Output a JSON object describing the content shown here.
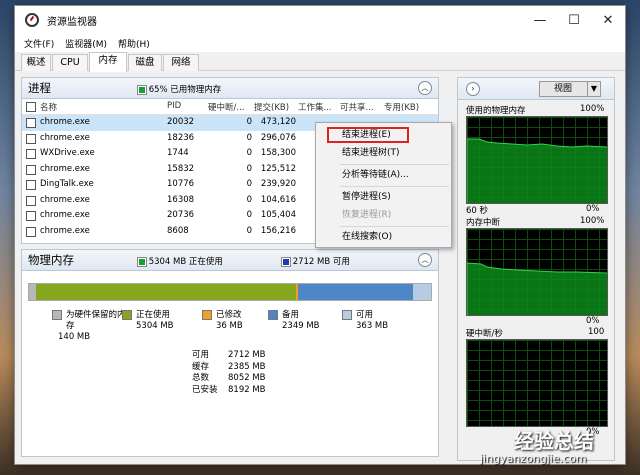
{
  "window": {
    "title": "资源监视器",
    "min": "—",
    "max": "☐",
    "close": "✕"
  },
  "menu": [
    "文件(F)",
    "监视器(M)",
    "帮助(H)"
  ],
  "tabs": [
    "概述",
    "CPU",
    "内存",
    "磁盘",
    "网络"
  ],
  "active_tab": "内存",
  "process": {
    "title": "进程",
    "usage": "65% 已用物理内存",
    "usage_color": "#1e9e2e",
    "columns": [
      "名称",
      "PID",
      "硬中断/...",
      "提交(KB)",
      "工作集...",
      "可共享...",
      "专用(KB)"
    ],
    "rows": [
      {
        "name": "chrome.exe",
        "pid": "20032",
        "hf": "0",
        "commit": "473,120",
        "ws": "",
        "sh": "",
        "pr": "",
        "selected": true
      },
      {
        "name": "chrome.exe",
        "pid": "18236",
        "hf": "0",
        "commit": "296,076",
        "ws": "",
        "sh": "",
        "pr": ""
      },
      {
        "name": "WXDrive.exe",
        "pid": "1744",
        "hf": "0",
        "commit": "158,300",
        "ws": "",
        "sh": "",
        "pr": ""
      },
      {
        "name": "chrome.exe",
        "pid": "15832",
        "hf": "0",
        "commit": "125,512",
        "ws": "",
        "sh": "",
        "pr": ""
      },
      {
        "name": "DingTalk.exe",
        "pid": "10776",
        "hf": "0",
        "commit": "239,920",
        "ws": "",
        "sh": "",
        "pr": ""
      },
      {
        "name": "chrome.exe",
        "pid": "16308",
        "hf": "0",
        "commit": "104,616",
        "ws": "",
        "sh": "",
        "pr": ""
      },
      {
        "name": "chrome.exe",
        "pid": "20736",
        "hf": "0",
        "commit": "105,404",
        "ws": "",
        "sh": "",
        "pr": ""
      },
      {
        "name": "chrome.exe",
        "pid": "8608",
        "hf": "0",
        "commit": "156,216",
        "ws": "",
        "sh": "",
        "pr": ""
      }
    ]
  },
  "context_menu": {
    "items": [
      {
        "label": "结束进程(E)",
        "disabled": false
      },
      {
        "label": "结束进程树(T)",
        "disabled": false
      },
      {
        "label": "分析等待链(A)...",
        "disabled": false
      },
      {
        "label": "暂停进程(S)",
        "disabled": false
      },
      {
        "label": "恢复进程(R)",
        "disabled": true
      },
      {
        "label": "在线搜索(O)",
        "disabled": false
      }
    ]
  },
  "physical": {
    "title": "物理内存",
    "in_use": "5304 MB 正在使用",
    "available": "2712 MB 可用",
    "in_use_color": "#1e9e2e",
    "available_color": "#1b3fa8",
    "bar": {
      "reserved_mb": 140,
      "in_use_mb": 5304,
      "modified_mb": 36,
      "standby_mb": 2349,
      "free_mb": 363
    },
    "legend": [
      {
        "label": "为硬件保留的内存",
        "value": "140 MB",
        "color": "#b8b8b8"
      },
      {
        "label": "正在使用",
        "value": "5304 MB",
        "color": "#86a61d"
      },
      {
        "label": "已修改",
        "value": "36 MB",
        "color": "#f0a028"
      },
      {
        "label": "备用",
        "value": "2349 MB",
        "color": "#4f86c6"
      },
      {
        "label": "可用",
        "value": "363 MB",
        "color": "#b7cce4"
      }
    ],
    "summary": [
      {
        "k": "可用",
        "v": "2712 MB"
      },
      {
        "k": "缓存",
        "v": "2385 MB"
      },
      {
        "k": "总数",
        "v": "8052 MB"
      },
      {
        "k": "已安装",
        "v": "8192 MB"
      }
    ]
  },
  "graphs": {
    "view_label": "视图",
    "graph1": {
      "label": "使用的物理内存",
      "max": "100%",
      "time": "60 秒",
      "min": "0%"
    },
    "graph2": {
      "label": "内存中断",
      "max": "100%",
      "min": "0%"
    },
    "graph3": {
      "label": "硬中断/秒",
      "max": "100",
      "min": "0%"
    }
  },
  "watermark": {
    "line1": "经验总结",
    "line2": "jingyanzongjie.com"
  }
}
